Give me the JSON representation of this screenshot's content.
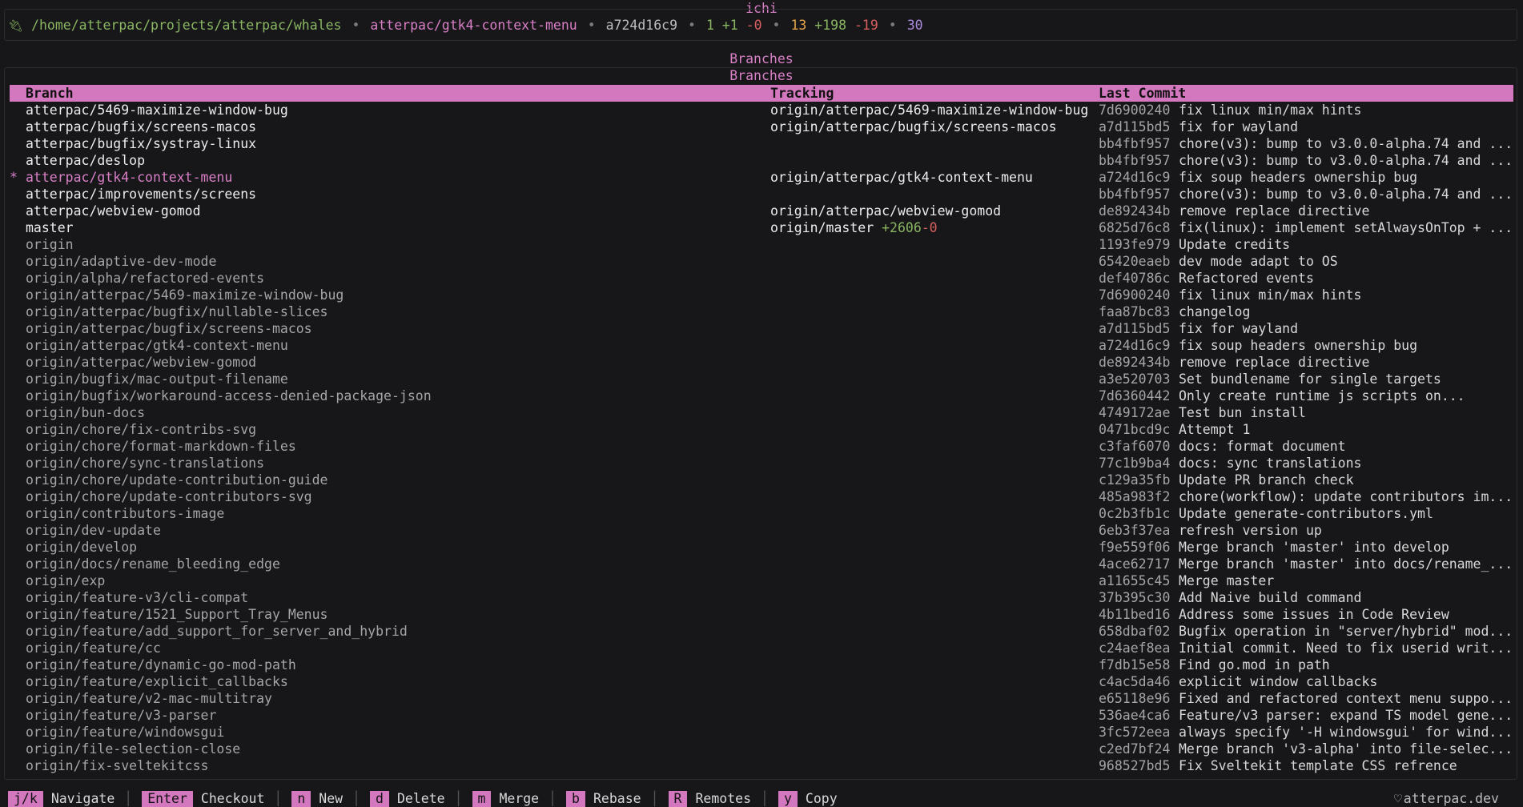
{
  "app_title": "ichi",
  "status": {
    "path": "/home/atterpac/projects/atterpac/whales",
    "branch": "atterpac/gtk4-context-menu",
    "commit": "a724d16c9",
    "staged": "1",
    "staged_add": "+1",
    "staged_del": "-0",
    "changed": "13",
    "changed_add": "+198",
    "changed_del": "-19",
    "count": "30",
    "separator": "•"
  },
  "section_title": "Branches",
  "panel_title": "Branches",
  "columns": {
    "branch": "Branch",
    "tracking": "Tracking",
    "last_commit": "Last Commit"
  },
  "branches": [
    {
      "mark": "",
      "name": "atterpac/5469-maximize-window-bug",
      "tracking": "origin/atterpac/5469-maximize-window-bug",
      "ahead": "",
      "behind": "",
      "hash": "7d6900240",
      "message": "fix linux min/max hints",
      "kind": "local"
    },
    {
      "mark": "",
      "name": "atterpac/bugfix/screens-macos",
      "tracking": "origin/atterpac/bugfix/screens-macos",
      "ahead": "",
      "behind": "",
      "hash": "a7d115bd5",
      "message": "fix for wayland",
      "kind": "local"
    },
    {
      "mark": "",
      "name": "atterpac/bugfix/systray-linux",
      "tracking": "",
      "ahead": "",
      "behind": "",
      "hash": "bb4fbf957",
      "message": "chore(v3): bump to v3.0.0-alpha.74 and ...",
      "kind": "local"
    },
    {
      "mark": "",
      "name": "atterpac/deslop",
      "tracking": "",
      "ahead": "",
      "behind": "",
      "hash": "bb4fbf957",
      "message": "chore(v3): bump to v3.0.0-alpha.74 and ...",
      "kind": "local"
    },
    {
      "mark": "*",
      "name": "atterpac/gtk4-context-menu",
      "tracking": "origin/atterpac/gtk4-context-menu",
      "ahead": "",
      "behind": "",
      "hash": "a724d16c9",
      "message": "fix soup headers ownership bug",
      "kind": "current"
    },
    {
      "mark": "",
      "name": "atterpac/improvements/screens",
      "tracking": "",
      "ahead": "",
      "behind": "",
      "hash": "bb4fbf957",
      "message": "chore(v3): bump to v3.0.0-alpha.74 and ...",
      "kind": "local"
    },
    {
      "mark": "",
      "name": "atterpac/webview-gomod",
      "tracking": "origin/atterpac/webview-gomod",
      "ahead": "",
      "behind": "",
      "hash": "de892434b",
      "message": "remove replace directive",
      "kind": "local"
    },
    {
      "mark": "",
      "name": "master",
      "tracking": "origin/master",
      "ahead": "+2606",
      "behind": "-0",
      "hash": "6825d76c8",
      "message": "fix(linux): implement setAlwaysOnTop + ...",
      "kind": "local"
    },
    {
      "mark": "",
      "name": "origin",
      "tracking": "",
      "ahead": "",
      "behind": "",
      "hash": "1193fe979",
      "message": "Update credits",
      "kind": "remote"
    },
    {
      "mark": "",
      "name": "origin/adaptive-dev-mode",
      "tracking": "",
      "ahead": "",
      "behind": "",
      "hash": "65420eaeb",
      "message": "dev mode adapt to OS",
      "kind": "remote"
    },
    {
      "mark": "",
      "name": "origin/alpha/refactored-events",
      "tracking": "",
      "ahead": "",
      "behind": "",
      "hash": "def40786c",
      "message": "Refactored events",
      "kind": "remote"
    },
    {
      "mark": "",
      "name": "origin/atterpac/5469-maximize-window-bug",
      "tracking": "",
      "ahead": "",
      "behind": "",
      "hash": "7d6900240",
      "message": "fix linux min/max hints",
      "kind": "remote"
    },
    {
      "mark": "",
      "name": "origin/atterpac/bugfix/nullable-slices",
      "tracking": "",
      "ahead": "",
      "behind": "",
      "hash": "faa87bc83",
      "message": "changelog",
      "kind": "remote"
    },
    {
      "mark": "",
      "name": "origin/atterpac/bugfix/screens-macos",
      "tracking": "",
      "ahead": "",
      "behind": "",
      "hash": "a7d115bd5",
      "message": "fix for wayland",
      "kind": "remote"
    },
    {
      "mark": "",
      "name": "origin/atterpac/gtk4-context-menu",
      "tracking": "",
      "ahead": "",
      "behind": "",
      "hash": "a724d16c9",
      "message": "fix soup headers ownership bug",
      "kind": "remote"
    },
    {
      "mark": "",
      "name": "origin/atterpac/webview-gomod",
      "tracking": "",
      "ahead": "",
      "behind": "",
      "hash": "de892434b",
      "message": "remove replace directive",
      "kind": "remote"
    },
    {
      "mark": "",
      "name": "origin/bugfix/mac-output-filename",
      "tracking": "",
      "ahead": "",
      "behind": "",
      "hash": "a3e520703",
      "message": "Set bundlename for single targets",
      "kind": "remote"
    },
    {
      "mark": "",
      "name": "origin/bugfix/workaround-access-denied-package-json",
      "tracking": "",
      "ahead": "",
      "behind": "",
      "hash": "7d6360442",
      "message": " Only create runtime js scripts on...",
      "kind": "remote"
    },
    {
      "mark": "",
      "name": "origin/bun-docs",
      "tracking": "",
      "ahead": "",
      "behind": "",
      "hash": "4749172ae",
      "message": "Test bun install",
      "kind": "remote"
    },
    {
      "mark": "",
      "name": "origin/chore/fix-contribs-svg",
      "tracking": "",
      "ahead": "",
      "behind": "",
      "hash": "0471bcd9c",
      "message": "Attempt 1",
      "kind": "remote"
    },
    {
      "mark": "",
      "name": "origin/chore/format-markdown-files",
      "tracking": "",
      "ahead": "",
      "behind": "",
      "hash": "c3faf6070",
      "message": "docs: format document",
      "kind": "remote"
    },
    {
      "mark": "",
      "name": "origin/chore/sync-translations",
      "tracking": "",
      "ahead": "",
      "behind": "",
      "hash": "77c1b9ba4",
      "message": "docs: sync translations",
      "kind": "remote"
    },
    {
      "mark": "",
      "name": "origin/chore/update-contribution-guide",
      "tracking": "",
      "ahead": "",
      "behind": "",
      "hash": "c129a35fb",
      "message": "Update PR branch check",
      "kind": "remote"
    },
    {
      "mark": "",
      "name": "origin/chore/update-contributors-svg",
      "tracking": "",
      "ahead": "",
      "behind": "",
      "hash": "485a983f2",
      "message": "chore(workflow): update contributors im...",
      "kind": "remote"
    },
    {
      "mark": "",
      "name": "origin/contributors-image",
      "tracking": "",
      "ahead": "",
      "behind": "",
      "hash": "0c2b3fb1c",
      "message": "Update generate-contributors.yml",
      "kind": "remote"
    },
    {
      "mark": "",
      "name": "origin/dev-update",
      "tracking": "",
      "ahead": "",
      "behind": "",
      "hash": "6eb3f37ea",
      "message": "refresh version up",
      "kind": "remote"
    },
    {
      "mark": "",
      "name": "origin/develop",
      "tracking": "",
      "ahead": "",
      "behind": "",
      "hash": "f9e559f06",
      "message": "Merge branch 'master' into develop",
      "kind": "remote"
    },
    {
      "mark": "",
      "name": "origin/docs/rename_bleeding_edge",
      "tracking": "",
      "ahead": "",
      "behind": "",
      "hash": "4ace62717",
      "message": "Merge branch 'master' into docs/rename_...",
      "kind": "remote"
    },
    {
      "mark": "",
      "name": "origin/exp",
      "tracking": "",
      "ahead": "",
      "behind": "",
      "hash": "a11655c45",
      "message": "Merge master",
      "kind": "remote"
    },
    {
      "mark": "",
      "name": "origin/feature-v3/cli-compat",
      "tracking": "",
      "ahead": "",
      "behind": "",
      "hash": "37b395c30",
      "message": " Add Naive build command",
      "kind": "remote"
    },
    {
      "mark": "",
      "name": "origin/feature/1521_Support_Tray_Menus",
      "tracking": "",
      "ahead": "",
      "behind": "",
      "hash": "4b11bed16",
      "message": "Address some issues in Code Review",
      "kind": "remote"
    },
    {
      "mark": "",
      "name": "origin/feature/add_support_for_server_and_hybrid",
      "tracking": "",
      "ahead": "",
      "behind": "",
      "hash": "658dbaf02",
      "message": "Bugfix operation in \"server/hybrid\" mod...",
      "kind": "remote"
    },
    {
      "mark": "",
      "name": "origin/feature/cc",
      "tracking": "",
      "ahead": "",
      "behind": "",
      "hash": "c24aef8ea",
      "message": "Initial commit. Need to fix userid writ...",
      "kind": "remote"
    },
    {
      "mark": "",
      "name": "origin/feature/dynamic-go-mod-path",
      "tracking": "",
      "ahead": "",
      "behind": "",
      "hash": "f7db15e58",
      "message": "Find go.mod in path",
      "kind": "remote"
    },
    {
      "mark": "",
      "name": "origin/feature/explicit_callbacks",
      "tracking": "",
      "ahead": "",
      "behind": "",
      "hash": "c4ac5da46",
      "message": " explicit window callbacks",
      "kind": "remote"
    },
    {
      "mark": "",
      "name": "origin/feature/v2-mac-multitray",
      "tracking": "",
      "ahead": "",
      "behind": "",
      "hash": "e65118e96",
      "message": "Fixed and refactored context menu suppo...",
      "kind": "remote"
    },
    {
      "mark": "",
      "name": "origin/feature/v3-parser",
      "tracking": "",
      "ahead": "",
      "behind": "",
      "hash": "536ae4ca6",
      "message": "Feature/v3 parser: expand TS model gene...",
      "kind": "remote"
    },
    {
      "mark": "",
      "name": "origin/feature/windowsgui",
      "tracking": "",
      "ahead": "",
      "behind": "",
      "hash": "3fc572eea",
      "message": "always specify '-H windowsgui' for wind...",
      "kind": "remote"
    },
    {
      "mark": "",
      "name": "origin/file-selection-close",
      "tracking": "",
      "ahead": "",
      "behind": "",
      "hash": "c2ed7bf24",
      "message": "Merge branch 'v3-alpha' into file-selec...",
      "kind": "remote"
    },
    {
      "mark": "",
      "name": "origin/fix-sveltekitcss",
      "tracking": "",
      "ahead": "",
      "behind": "",
      "hash": "968527bd5",
      "message": "Fix Sveltekit template CSS refrence",
      "kind": "remote"
    }
  ],
  "footer": {
    "keys": [
      {
        "key": "j/k",
        "label": "Navigate"
      },
      {
        "key": "Enter",
        "label": "Checkout"
      },
      {
        "key": "n",
        "label": "New"
      },
      {
        "key": "d",
        "label": "Delete"
      },
      {
        "key": "m",
        "label": "Merge"
      },
      {
        "key": "b",
        "label": "Rebase"
      },
      {
        "key": "R",
        "label": "Remotes"
      },
      {
        "key": "y",
        "label": "Copy"
      }
    ],
    "separator": "│",
    "brand": "atterpac.dev",
    "brand_icon": "heart-icon"
  },
  "colors": {
    "accent": "#d378bf",
    "green": "#8ab662",
    "red": "#d85f5f",
    "orange": "#e3a54a",
    "purple": "#a989d8",
    "background": "#17171a"
  }
}
